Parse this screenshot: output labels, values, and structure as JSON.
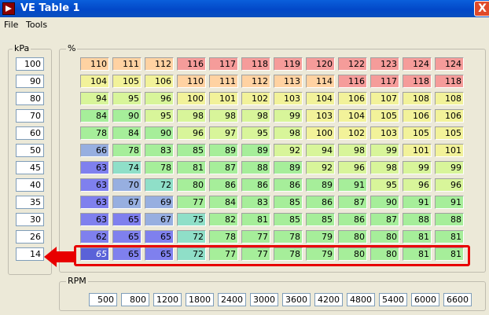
{
  "window": {
    "title": "VE Table 1",
    "close_label": "X"
  },
  "menu": {
    "items": [
      "File",
      "Tools"
    ]
  },
  "kpa_group": {
    "label": "kPa",
    "values": [
      "100",
      "90",
      "80",
      "70",
      "60",
      "50",
      "45",
      "40",
      "35",
      "30",
      "26",
      "14"
    ]
  },
  "table_group": {
    "label": "%"
  },
  "rpm_group": {
    "label": "RPM",
    "values": [
      "500",
      "800",
      "1200",
      "1800",
      "2400",
      "3000",
      "3600",
      "4200",
      "4800",
      "5400",
      "6000",
      "6600"
    ]
  },
  "ve_table": [
    [
      "110",
      "111",
      "112",
      "116",
      "117",
      "118",
      "119",
      "120",
      "122",
      "123",
      "124",
      "124"
    ],
    [
      "104",
      "105",
      "106",
      "110",
      "111",
      "112",
      "113",
      "114",
      "116",
      "117",
      "118",
      "118"
    ],
    [
      "94",
      "95",
      "96",
      "100",
      "101",
      "102",
      "103",
      "104",
      "106",
      "107",
      "108",
      "108"
    ],
    [
      "84",
      "90",
      "95",
      "98",
      "98",
      "98",
      "99",
      "103",
      "104",
      "105",
      "106",
      "106"
    ],
    [
      "78",
      "84",
      "90",
      "96",
      "97",
      "95",
      "98",
      "100",
      "102",
      "103",
      "105",
      "105"
    ],
    [
      "66",
      "78",
      "83",
      "85",
      "89",
      "89",
      "92",
      "94",
      "98",
      "99",
      "101",
      "101"
    ],
    [
      "63",
      "74",
      "78",
      "81",
      "87",
      "88",
      "89",
      "92",
      "96",
      "98",
      "99",
      "99"
    ],
    [
      "63",
      "70",
      "72",
      "80",
      "86",
      "86",
      "86",
      "89",
      "91",
      "95",
      "96",
      "96"
    ],
    [
      "63",
      "67",
      "69",
      "77",
      "84",
      "83",
      "85",
      "86",
      "87",
      "90",
      "91",
      "91"
    ],
    [
      "63",
      "65",
      "67",
      "75",
      "82",
      "81",
      "85",
      "85",
      "86",
      "87",
      "88",
      "88"
    ],
    [
      "62",
      "65",
      "65",
      "72",
      "78",
      "77",
      "78",
      "79",
      "80",
      "80",
      "81",
      "81"
    ],
    [
      "65",
      "65",
      "65",
      "72",
      "77",
      "77",
      "78",
      "79",
      "80",
      "80",
      "81",
      "81"
    ]
  ],
  "colors": {
    "cell_scale": [
      "#7F80EE",
      "#97AFE0",
      "#8FDFC8",
      "#A6EE9A",
      "#D8F59A",
      "#F2F29A",
      "#FFD2A2",
      "#F59C9A"
    ],
    "highlight": "#E80000",
    "titlebar": "#0A5FDB"
  },
  "selected_cell": {
    "row": 11,
    "col": 0
  }
}
